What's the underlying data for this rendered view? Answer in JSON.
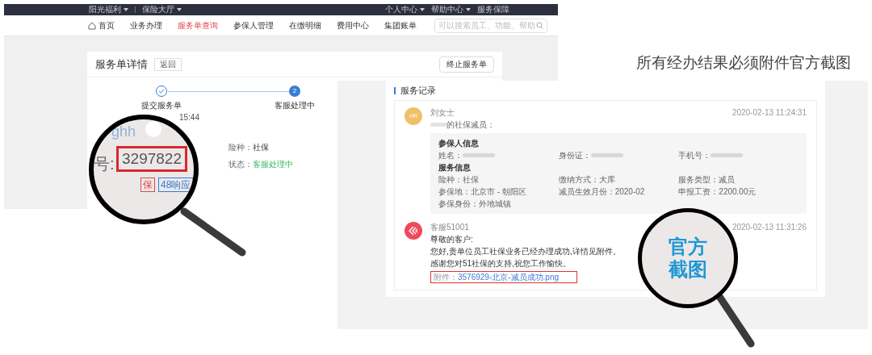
{
  "top_bar": {
    "left_menus": [
      {
        "label": "阳光福利",
        "dropdown": true
      },
      {
        "label": "保险大厅",
        "dropdown": true
      }
    ],
    "right_menus": [
      {
        "label": "个人中心",
        "dropdown": true
      },
      {
        "label": "帮助中心",
        "dropdown": true
      },
      {
        "label": "服务保障",
        "dropdown": false
      }
    ]
  },
  "nav": {
    "items": [
      {
        "label": "首页",
        "selected": false
      },
      {
        "label": "业务办理",
        "selected": false
      },
      {
        "label": "服务单查询",
        "selected": true
      },
      {
        "label": "参保人管理",
        "selected": false
      },
      {
        "label": "在缴明细",
        "selected": false
      },
      {
        "label": "费用中心",
        "selected": false
      },
      {
        "label": "集团账单",
        "selected": false
      }
    ],
    "search": {
      "placeholder": "可以搜索员工、功能、帮助"
    }
  },
  "order_detail": {
    "title": "服务单详情",
    "back_button": "返回",
    "terminate_button": "终止服务单",
    "steps": [
      {
        "label": "提交服务单",
        "time": "15:44",
        "completed": true
      },
      {
        "label": "客服处理中",
        "number": "2",
        "completed": false
      }
    ],
    "fields": [
      {
        "label": "险种：",
        "value": "社保",
        "kind": "plain"
      },
      {
        "label": "状态：",
        "value": "客服处理中",
        "kind": "status"
      }
    ]
  },
  "magnifier_left": {
    "ghost_text": "ghh",
    "number_label": "号:",
    "order_number": "3297822",
    "tags": [
      {
        "label": "保",
        "color": "#e0464b"
      },
      {
        "label": "48响应",
        "color": "#3a7bd5"
      }
    ]
  },
  "caption": "所有经办结果必须附件官方截图",
  "service_records": {
    "title": "服务记录",
    "records": [
      {
        "kind": "user",
        "avatar": "HR",
        "name": "刘女士",
        "time": "2020-02-13 11:24:31",
        "message": "的社保减员：",
        "sections": [
          {
            "title": "参保人信息",
            "fields": [
              {
                "label": "姓名：",
                "masked": true
              },
              {
                "label": "身份证：",
                "masked": true
              },
              {
                "label": "手机号：",
                "masked": true
              }
            ]
          },
          {
            "title": "服务信息",
            "fields": [
              {
                "label": "险种：",
                "value": "社保",
                "masked": false
              },
              {
                "label": "缴纳方式：",
                "value": "大库",
                "masked": false
              },
              {
                "label": "服务类型：",
                "value": "减员",
                "masked": false
              },
              {
                "label": "参保地：",
                "value": "北京市 - 朝阳区",
                "masked": false
              },
              {
                "label": "减员生效月份：",
                "value": "2020-02",
                "masked": false
              },
              {
                "label": "申报工资：",
                "value": "2200.00元",
                "masked": false
              },
              {
                "label": "参保身份：",
                "value": "外地城镇",
                "masked": false
              }
            ]
          }
        ]
      },
      {
        "kind": "agent",
        "name": "客服51001",
        "time": "2020-02-13 11:31:26",
        "lines": [
          "尊敬的客户:",
          "您好,贵单位员工社保业务已经办理成功,详情见附件。",
          "感谢您对51社保的支持,祝您工作愉快。"
        ],
        "attachment": {
          "label": "附件：",
          "file": "3576929-北京-减员成功.png",
          "highlighted": true
        }
      }
    ]
  },
  "magnifier_right": {
    "lines": [
      "官方",
      "截图"
    ]
  }
}
